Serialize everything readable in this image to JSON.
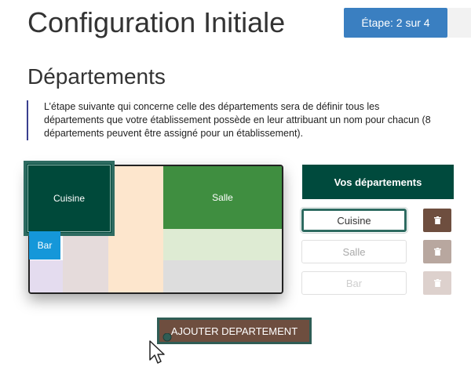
{
  "header": {
    "title": "Configuration Initiale",
    "step_label": "Étape: 2 sur 4"
  },
  "section": {
    "title": "Départements",
    "description": "L’étape suivante qui concerne celle des départements sera de définir tous les départements que votre établissement possède en leur attribuant un nom pour chacun (8 départements peuvent être assigné pour un établissement)."
  },
  "floor_plan": {
    "zones": {
      "cuisine": "Cuisine",
      "salle": "Salle",
      "bar": "Bar"
    },
    "colors": {
      "cuisine": "#00493a",
      "salle": "#3f8e40",
      "bar": "#1597d9"
    }
  },
  "departments_panel": {
    "header": "Vos départements",
    "items": [
      {
        "name": "Cuisine"
      },
      {
        "name": "Salle"
      },
      {
        "name": "Bar"
      }
    ],
    "delete_icon": "trash-icon"
  },
  "actions": {
    "add_department": "AJOUTER DEPARTEMENT"
  }
}
